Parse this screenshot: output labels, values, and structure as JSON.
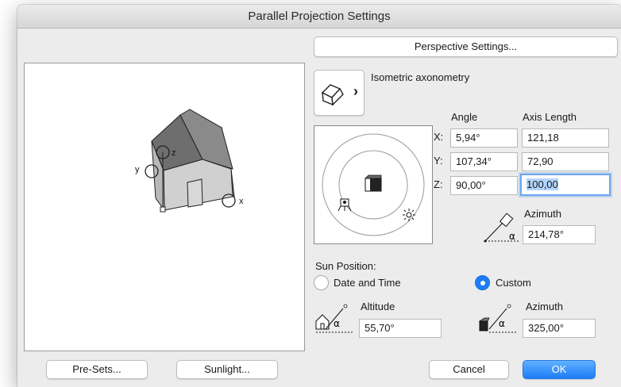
{
  "window": {
    "title": "Parallel Projection Settings"
  },
  "perspective_button": "Perspective Settings...",
  "projection": {
    "name": "Isometric axonometry",
    "chevron": "›",
    "icon": "house-icon"
  },
  "preview": {
    "axis_x": "x",
    "axis_y": "y",
    "axis_z": "z"
  },
  "angles": {
    "angle_header": "Angle",
    "axis_length_header": "Axis Length",
    "rows": [
      {
        "label": "X:",
        "angle": "5,94°",
        "length": "121,18"
      },
      {
        "label": "Y:",
        "angle": "107,34°",
        "length": "72,90"
      },
      {
        "label": "Z:",
        "angle": "90,00°",
        "length": "100,00"
      }
    ]
  },
  "camera_azimuth": {
    "label": "Azimuth",
    "value": "214,78°",
    "alpha": "α"
  },
  "sun": {
    "section_label": "Sun Position:",
    "option_date_time": "Date and Time",
    "option_custom": "Custom",
    "selected": "custom",
    "altitude_label": "Altitude",
    "altitude_value": "55,70°",
    "azimuth_label": "Azimuth",
    "azimuth_value": "325,00°",
    "alpha": "α"
  },
  "footer": {
    "presets": "Pre-Sets...",
    "sunlight": "Sunlight...",
    "cancel": "Cancel",
    "ok": "OK"
  },
  "colors": {
    "accent": "#1e7df6",
    "window_bg": "#ececec",
    "roof": "#7c7c7c",
    "wall": "#c9c9c9"
  }
}
